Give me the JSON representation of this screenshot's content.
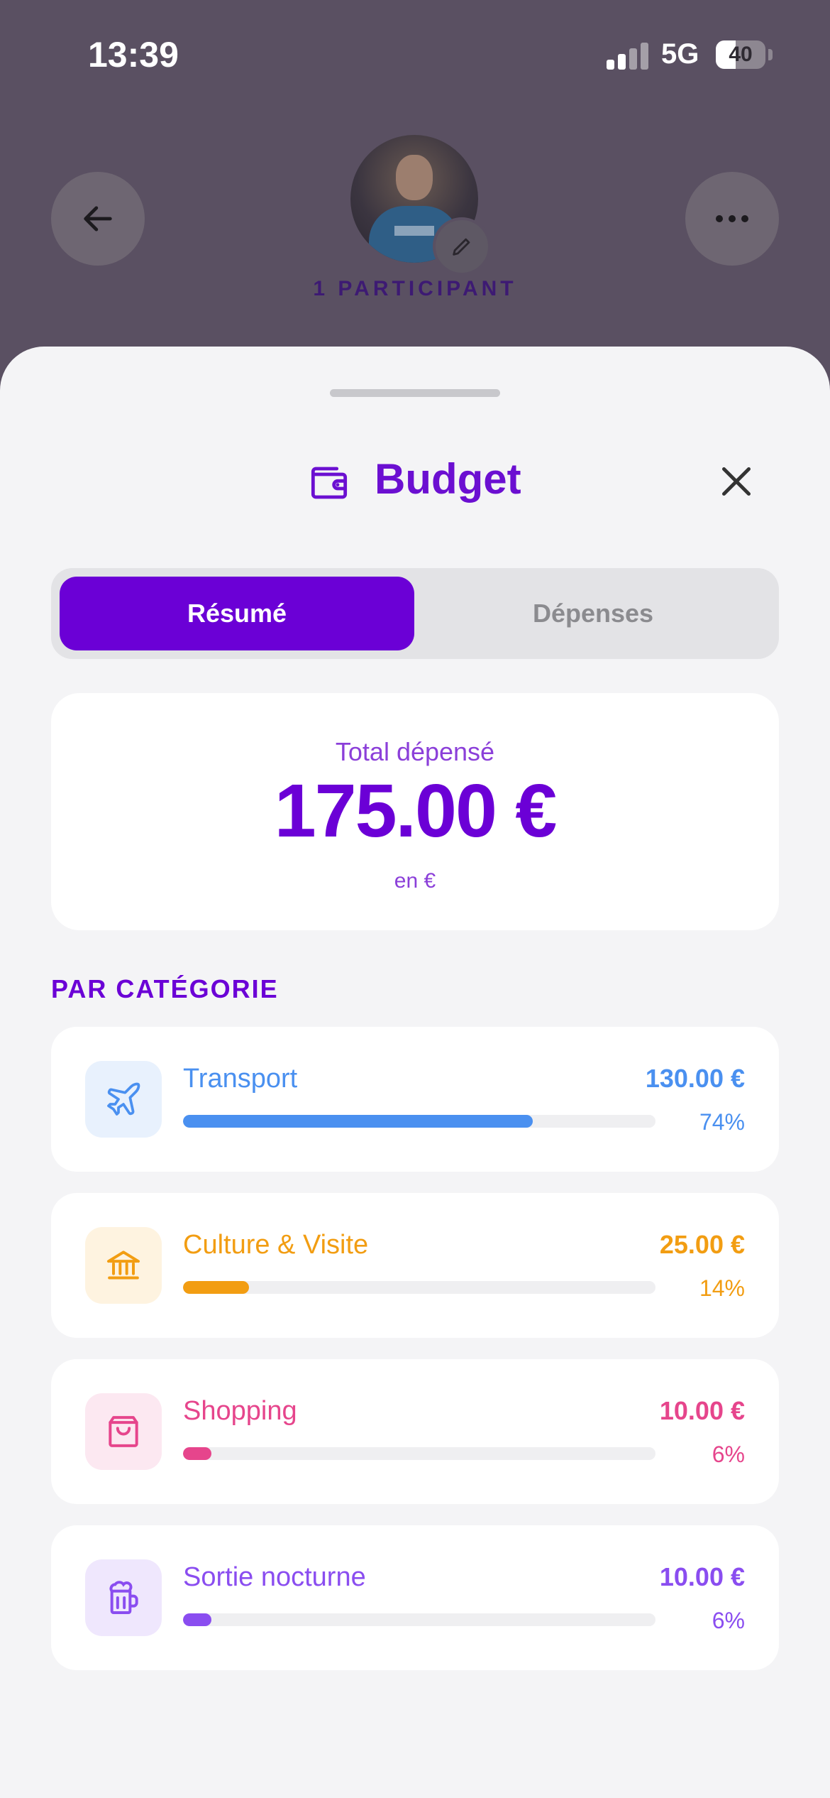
{
  "status_bar": {
    "time": "13:39",
    "network": "5G",
    "battery_level": "40",
    "battery_fraction": 0.4
  },
  "header": {
    "participants": "1 PARTICIPANT"
  },
  "sheet": {
    "title": "Budget",
    "tabs": [
      {
        "label": "Résumé",
        "active": true
      },
      {
        "label": "Dépenses",
        "active": false
      }
    ],
    "total": {
      "label": "Total dépensé",
      "value": "175.00 €",
      "unit": "en €"
    },
    "section_title": "PAR CATÉGORIE",
    "categories": [
      {
        "name": "Transport",
        "amount": "130.00 €",
        "percent_label": "74%",
        "fraction": 0.74,
        "color": "#4a90f0",
        "icon_bg": "#e8f1fd",
        "icon": "airplane-icon"
      },
      {
        "name": "Culture & Visite",
        "amount": "25.00 €",
        "percent_label": "14%",
        "fraction": 0.14,
        "color": "#f29d12",
        "icon_bg": "#fef3e0",
        "icon": "museum-icon"
      },
      {
        "name": "Shopping",
        "amount": "10.00 €",
        "percent_label": "6%",
        "fraction": 0.06,
        "color": "#e6458c",
        "icon_bg": "#fce8f1",
        "icon": "shopping-bag-icon"
      },
      {
        "name": "Sortie nocturne",
        "amount": "10.00 €",
        "percent_label": "6%",
        "fraction": 0.06,
        "color": "#8a4df0",
        "icon_bg": "#efe7fd",
        "icon": "beer-mug-icon"
      }
    ]
  }
}
